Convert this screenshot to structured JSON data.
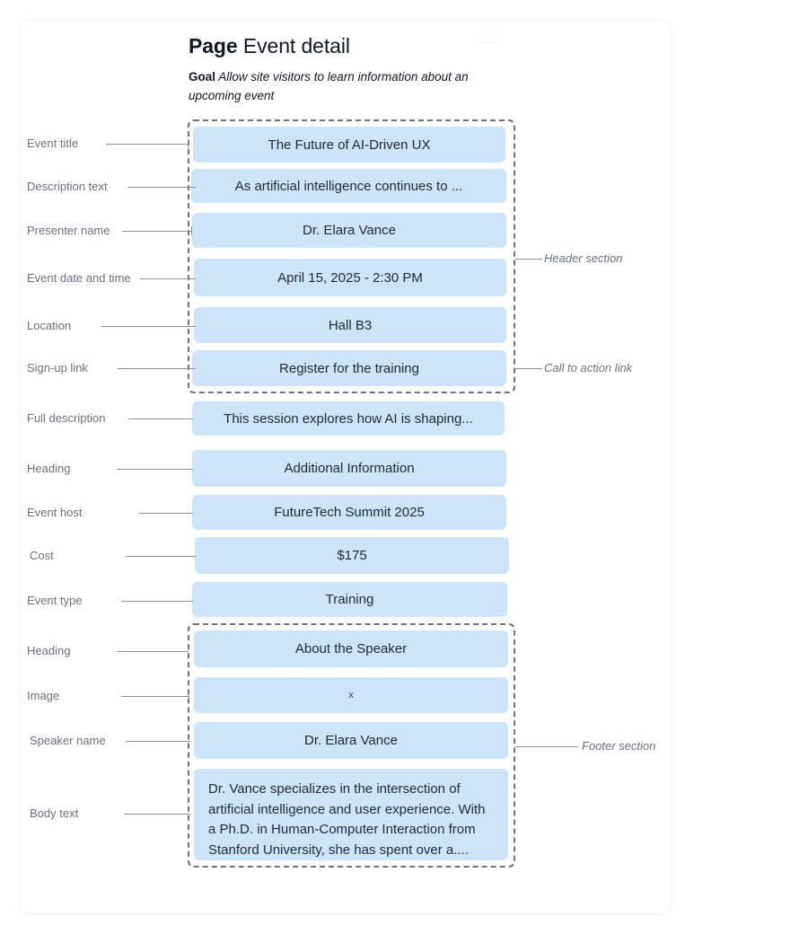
{
  "header": {
    "title_strong": "Page",
    "title_rest": "Event detail",
    "goal_key": "Goal",
    "goal_text": "Allow site visitors to learn information about an upcoming event"
  },
  "theme": {
    "block_fill": "#cce5f8",
    "frame_stroke": "#6e7479",
    "label_color": "#6b7280",
    "text_color": "#1f2937"
  },
  "sections": {
    "header_section_label": "Header section",
    "cta_label": "Call to action link",
    "footer_section_label": "Footer section"
  },
  "rows": [
    {
      "label": "Event title",
      "value": "The Future of AI-Driven UX"
    },
    {
      "label": "Description text",
      "value": "As artificial intelligence continues to ..."
    },
    {
      "label": "Presenter name",
      "value": "Dr. Elara Vance"
    },
    {
      "label": "Event date and time",
      "value": "April 15, 2025 - 2:30 PM"
    },
    {
      "label": "Location",
      "value": "Hall B3"
    },
    {
      "label": "Sign-up link",
      "value": "Register for the training"
    },
    {
      "label": "Full description",
      "value": "This session explores how AI is shaping..."
    },
    {
      "label": "Heading",
      "value": "Additional Information"
    },
    {
      "label": "Event host",
      "value": "FutureTech Summit 2025"
    },
    {
      "label": "Cost",
      "value": "$175"
    },
    {
      "label": "Event type",
      "value": "Training"
    },
    {
      "label": "Heading",
      "value": "About the Speaker"
    },
    {
      "label": "Image",
      "value": "x"
    },
    {
      "label": "Speaker name",
      "value": "Dr. Elara Vance"
    },
    {
      "label": "Body text",
      "value": "Dr. Vance specializes in the intersection of artificial intelligence and user experience. With a Ph.D. in Human-Computer Interaction from Stanford University, she has spent over a...."
    }
  ]
}
